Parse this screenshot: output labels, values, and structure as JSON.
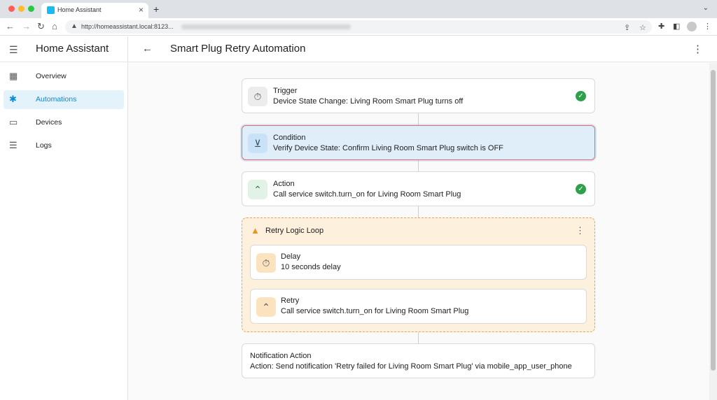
{
  "browser": {
    "traffic_colors": [
      "#ff5f57",
      "#febc2e",
      "#28c840"
    ],
    "tab_title": "Home Assistant",
    "tab_close": "×",
    "new_tab": "+",
    "tab_menu": "⌄",
    "back": "←",
    "forward": "→",
    "reload": "↻",
    "home": "⌂",
    "url": "http://homeassistant.local:8123..."
  },
  "sidebar": {
    "title": "Home Assistant",
    "items": [
      {
        "label": "Overview",
        "icon": "▦"
      },
      {
        "label": "Automations",
        "icon": "✱",
        "active": true
      },
      {
        "label": "Devices",
        "icon": "▭"
      },
      {
        "label": "Logs",
        "icon": "☰"
      }
    ]
  },
  "header": {
    "title": "Smart Plug Retry Automation"
  },
  "flow": {
    "trigger": {
      "title": "Trigger",
      "desc": "Device State Change: Living Room Smart Plug turns off",
      "icon": "⏱"
    },
    "condition": {
      "title": "Condition",
      "desc": "Verify Device State: Confirm Living Room Smart Plug switch is OFF",
      "icon": "⊻"
    },
    "action": {
      "title": "Action",
      "desc": "Call service switch.turn_on for Living Room Smart Plug",
      "icon": "⌃"
    },
    "loop": {
      "title": "Retry Logic Loop",
      "delay": {
        "title": "Delay",
        "desc": "10 seconds delay",
        "icon": "⏱"
      },
      "retry": {
        "title": "Retry",
        "desc": "Call service switch.turn_on for Living Room Smart Plug",
        "icon": "⌃"
      }
    },
    "notification": {
      "title": "Notification Action",
      "desc": "Action: Send notification 'Retry failed for Living Room Smart Plug' via mobile_app_user_phone"
    }
  },
  "colors": {
    "accent": "#0b8bd1",
    "success": "#2e9f4b",
    "warning": "#e69521"
  }
}
